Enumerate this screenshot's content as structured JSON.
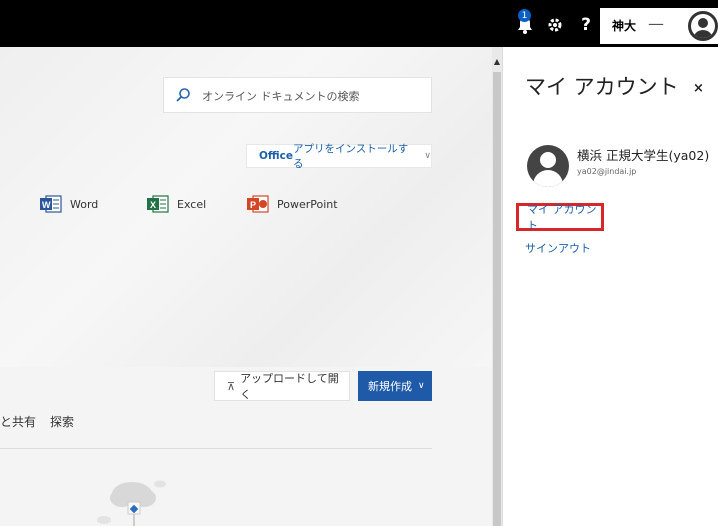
{
  "topbar": {
    "notification_count": "1",
    "help_label": "?",
    "user_name": "神大",
    "user_dash": "—"
  },
  "main": {
    "search": {
      "placeholder": "オンライン ドキュメントの検索"
    },
    "install": {
      "label_bold": "Office",
      "label": " アプリをインストールする",
      "chevron": "∨"
    },
    "apps": [
      {
        "label": "Word",
        "icon": "word-icon",
        "color": "#2b579a"
      },
      {
        "label": "Excel",
        "icon": "excel-icon",
        "color": "#217346"
      },
      {
        "label": "PowerPoint",
        "icon": "powerpoint-icon",
        "color": "#d24726"
      }
    ],
    "upload_label": "アップロードして開く",
    "upload_arrow": "⊼",
    "new_label": "新規作成",
    "new_chevron": "∨",
    "tabs": [
      "と共有",
      "探索"
    ]
  },
  "panel": {
    "title": "マイ アカウント",
    "close": "×",
    "account_name": "横浜 正規大学生(ya02)",
    "account_email": "ya02@jindai.jp",
    "my_account_link": "マイ アカウント",
    "sign_out_link": "サインアウト"
  },
  "colors": {
    "accent": "#1e5aa7",
    "link": "#1a5fa8",
    "highlight": "#d9262c",
    "topbar": "#000000"
  }
}
